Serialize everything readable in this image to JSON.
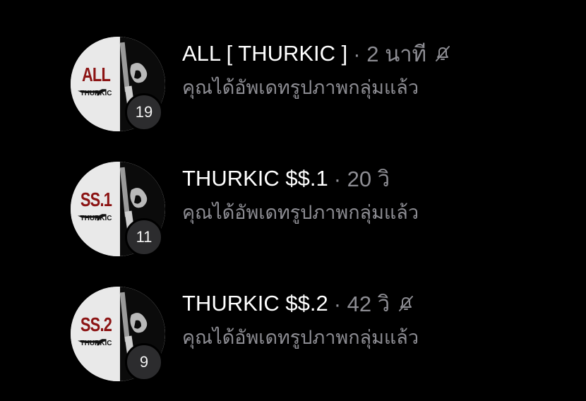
{
  "chats": [
    {
      "title": "ALL [ THURKIC ]",
      "time": "· 2 นาที",
      "muted": true,
      "preview": "คุณได้อัพเดทรูปภาพกลุ่มแล้ว",
      "unread": "19",
      "avatar_main": "ALL",
      "avatar_sub": "THURKIC"
    },
    {
      "title": "THURKIC $$.1",
      "time": "· 20 วิ",
      "muted": false,
      "preview": "คุณได้อัพเดทรูปภาพกลุ่มแล้ว",
      "unread": "11",
      "avatar_main": "SS.1",
      "avatar_sub": "THURKIC"
    },
    {
      "title": "THURKIC $$.2",
      "time": "· 42 วิ",
      "muted": true,
      "preview": "คุณได้อัพเดทรูปภาพกลุ่มแล้ว",
      "unread": "9",
      "avatar_main": "SS.2",
      "avatar_sub": "THURKIC"
    }
  ],
  "colors": {
    "background": "#000000",
    "title": "#ffffff",
    "secondary": "#8d8d93",
    "badge": "#2c2c2e",
    "avatar_red": "#8c1414"
  },
  "icons": {
    "mute": "bell-slash-icon"
  }
}
